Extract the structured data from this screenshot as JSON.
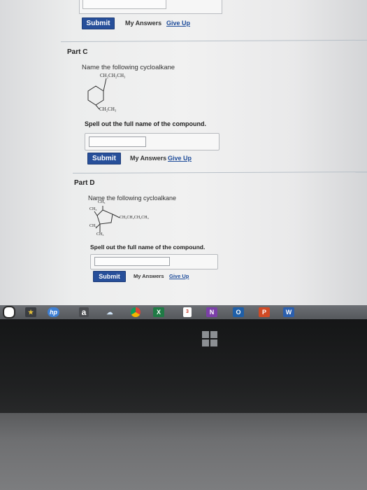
{
  "part_b": {
    "submit": "Submit",
    "my_answers": "My Answers",
    "give_up": "Give Up"
  },
  "part_c": {
    "title": "Part C",
    "prompt": "Name the following cycloalkane",
    "sub_top": "CH₂CH₂CH₃",
    "sub_bottom": "CH₂CH₃",
    "instruction": "Spell out the full name of the compound.",
    "answer_value": "",
    "submit": "Submit",
    "my_answers": "My Answers",
    "give_up": "Give Up"
  },
  "part_d": {
    "title": "Part D",
    "prompt": "Name the following cycloalkane",
    "label_ch3_top": "CH₃",
    "label_ch3_left": "CH₃",
    "label_chain": "CH₂CH₂CH₂CH₃",
    "label_ch3_low_left": "CH₃",
    "label_ch3_bottom": "CH₃",
    "instruction": "Spell out the full name of the compound.",
    "answer_value": "",
    "submit": "Submit",
    "my_answers": "My Answers",
    "give_up": "Give Up"
  },
  "taskbar": {
    "icons": [
      {
        "name": "start-icon"
      },
      {
        "name": "photos-app-icon"
      },
      {
        "name": "hp-icon",
        "text": "hp"
      },
      {
        "name": "amazon-icon",
        "text": "a"
      },
      {
        "name": "weather-icon"
      },
      {
        "name": "chrome-icon"
      },
      {
        "name": "excel-icon",
        "text": "X"
      },
      {
        "name": "app-badge-icon",
        "text": "3"
      },
      {
        "name": "onenote-icon",
        "text": "N"
      },
      {
        "name": "outlook-icon",
        "text": "O"
      },
      {
        "name": "powerpoint-icon",
        "text": "P"
      },
      {
        "name": "word-icon",
        "text": "W"
      }
    ]
  },
  "colors": {
    "button": "#274f9a",
    "link": "#1e4c9a",
    "taskbar": "#5e6165"
  }
}
